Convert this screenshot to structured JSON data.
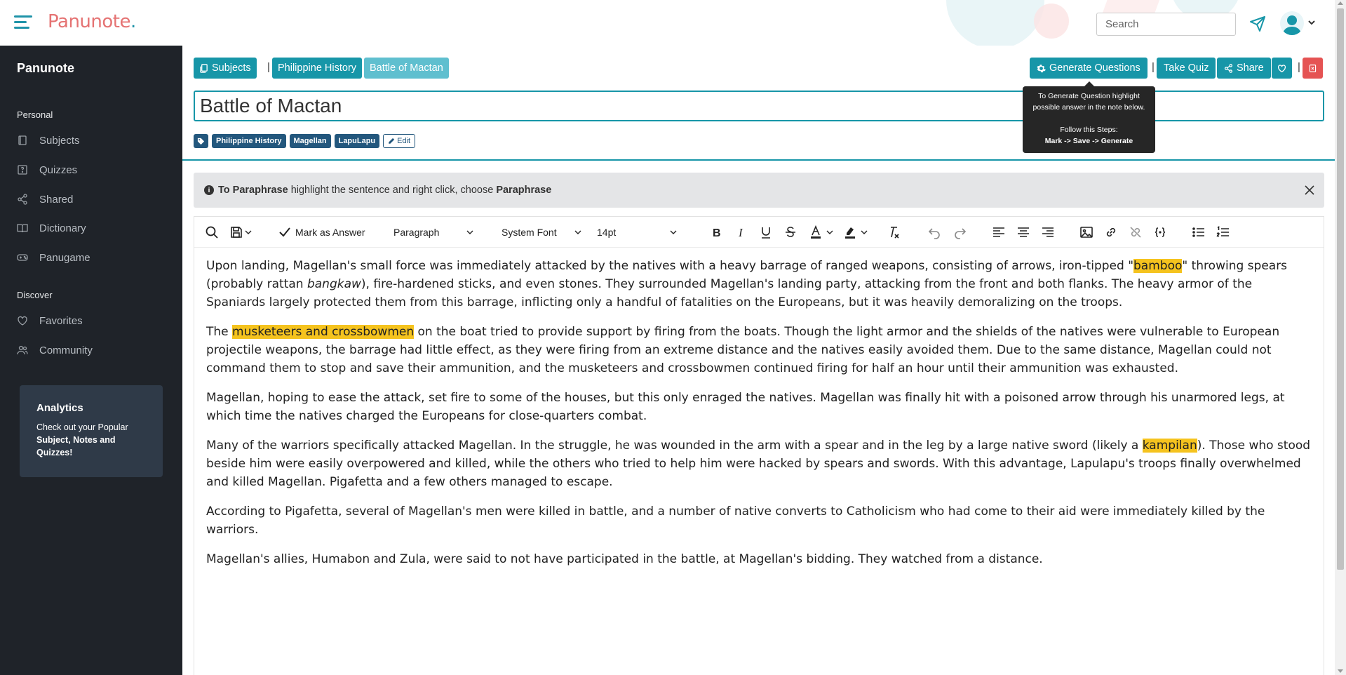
{
  "header": {
    "logo_main": "Panunote",
    "logo_dot": ".",
    "search_placeholder": "Search"
  },
  "sidebar": {
    "brand": "Panunote",
    "section_personal": "Personal",
    "personal_items": [
      {
        "label": "Subjects",
        "icon": "book-icon"
      },
      {
        "label": "Quizzes",
        "icon": "quiz-icon"
      },
      {
        "label": "Shared",
        "icon": "share-icon"
      },
      {
        "label": "Dictionary",
        "icon": "dictionary-icon"
      },
      {
        "label": "Panugame",
        "icon": "gamepad-icon"
      }
    ],
    "section_discover": "Discover",
    "discover_items": [
      {
        "label": "Favorites",
        "icon": "heart-icon"
      },
      {
        "label": "Community",
        "icon": "users-icon"
      }
    ],
    "analytics": {
      "title": "Analytics",
      "line1": "Check out your Popular",
      "line2": "Subject, Notes and",
      "line3": "Quizzes!"
    }
  },
  "breadcrumb": {
    "subjects": "Subjects",
    "sep": "|",
    "subject": "Philippine History",
    "note": "Battle of Mactan"
  },
  "actions": {
    "generate": "Generate Questions",
    "sep": "|",
    "take_quiz": "Take Quiz",
    "share": "Share"
  },
  "tooltip": {
    "line1": "To Generate Question highlight",
    "line2": "possible answer in the note below.",
    "line3": "Follow this Steps:",
    "line4": "Mark -> Save -> Generate"
  },
  "note": {
    "title": "Battle of Mactan",
    "tags": [
      "Philippine History",
      "Magellan",
      "LapuLapu"
    ],
    "edit_label": "Edit"
  },
  "alert": {
    "prefix": "To Paraphrase",
    "middle": " highlight the sentence and right click, choose ",
    "suffix": "Paraphrase"
  },
  "toolbar": {
    "mark_answer": "Mark as Answer",
    "block_format": "Paragraph",
    "font_family": "System Font",
    "font_size": "14pt"
  },
  "content": {
    "p1_a": "Upon landing, Magellan's small force was immediately attacked by the natives with a heavy barrage of ranged weapons, consisting of arrows, iron-tipped \"",
    "p1_hl": "bamboo",
    "p1_b": "\" throwing spears (probably rattan ",
    "p1_em": "bangkaw",
    "p1_c": "), fire-hardened sticks, and even stones. They surrounded Magellan's landing party, attacking from the front and both flanks. The heavy armor of the Spaniards largely protected them from this barrage, inflicting only a handful of fatalities on the Europeans, but it was heavily demoralizing on the troops.",
    "p2_a": "The ",
    "p2_hl": "musketeers and crossbowmen",
    "p2_b": " on the boat tried to provide support by firing from the boats. Though the light armor and the shields of the natives were vulnerable to European projectile weapons, the barrage had little effect, as they were firing from an extreme distance and the natives easily avoided them. Due to the same distance, Magellan could not command them to stop and save their ammunition, and the musketeers and crossbowmen continued firing for half an hour until their ammunition was exhausted.",
    "p3": "Magellan, hoping to ease the attack, set fire to some of the houses, but this only enraged the natives. Magellan was finally hit with a poisoned arrow through his unarmored legs, at which time the natives charged the Europeans for close-quarters combat.",
    "p4_a": "Many of the warriors specifically attacked Magellan. In the struggle, he was wounded in the arm with a spear and in the leg by a large native sword (likely a ",
    "p4_hl": "kampilan",
    "p4_b": "). Those who stood beside him were easily overpowered and killed, while the others who tried to help him were hacked by spears and swords. With this advantage, Lapulapu's troops finally overwhelmed and killed Magellan. Pigafetta and a few others managed to escape.",
    "p5": "According to Pigafetta, several of Magellan's men were killed in battle, and a number of native converts to Catholicism who had come to their aid were immediately killed by the warriors.",
    "p6": "Magellan's allies, Humabon and Zula, were said to not have participated in the battle, at Magellan's bidding. They watched from a distance."
  },
  "colors": {
    "accent": "#1796a8",
    "accent_light": "#5fbfcf",
    "tag": "#23577d",
    "sidebar_bg": "#1f2329",
    "highlight": "#f5c31e",
    "danger": "#e55353"
  }
}
